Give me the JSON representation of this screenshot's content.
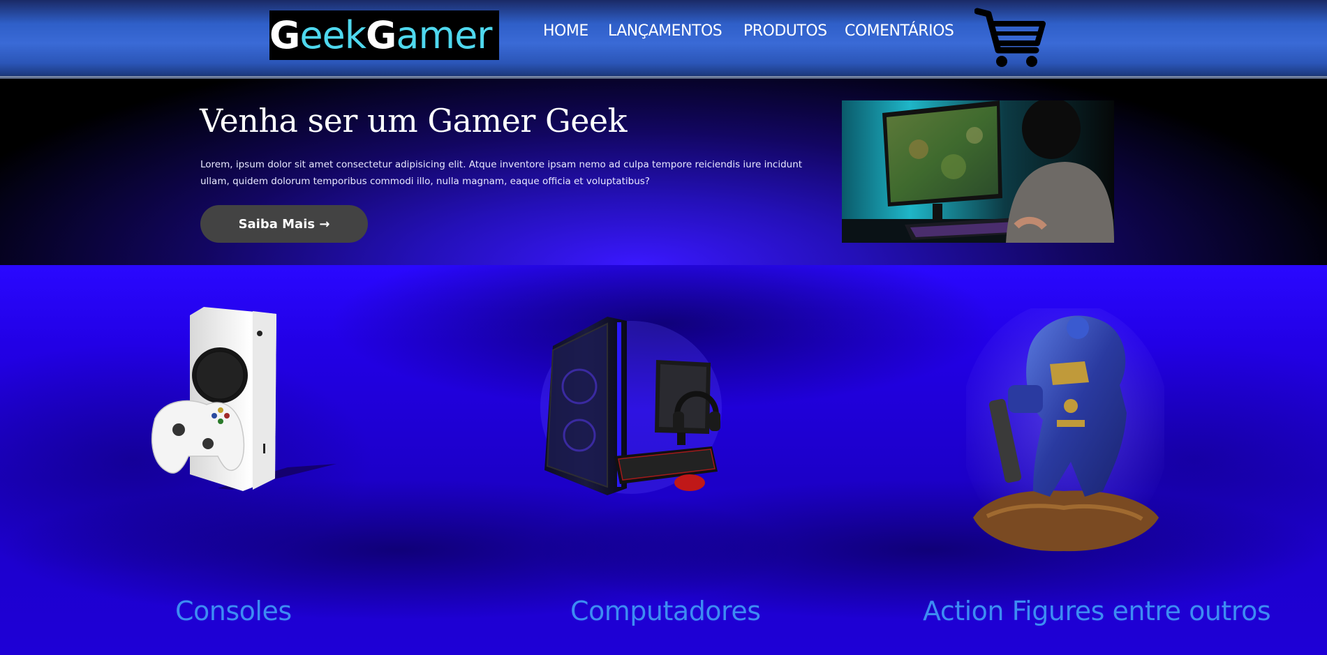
{
  "header": {
    "logo": {
      "g1": "G",
      "part1": "eek ",
      "g2": "G",
      "part2": "amer"
    },
    "nav": [
      "HOME",
      "LANÇAMENTOS",
      "PRODUTOS",
      "COMENTÁRIOS"
    ],
    "cart_icon": "shopping-cart-icon"
  },
  "hero": {
    "title": "Venha ser um Gamer Geek",
    "text": "Lorem, ipsum dolor sit amet consectetur adipisicing elit. Atque inventore ipsam nemo ad culpa tempore reiciendis iure incidunt ullam, quidem dolorum temporibus commodi illo, nulla magnam, eaque officia et voluptatibus?",
    "cta": "Saiba Mais →"
  },
  "products": [
    {
      "label": "Consoles"
    },
    {
      "label": "Computadores"
    },
    {
      "label": "Action Figures entre outros"
    }
  ],
  "colors": {
    "header": "#3a6ad6",
    "logo_accent": "#4fd8ee",
    "product_label": "#3d8cf2",
    "section_bg": "#1f00e0",
    "button": "#434343"
  }
}
